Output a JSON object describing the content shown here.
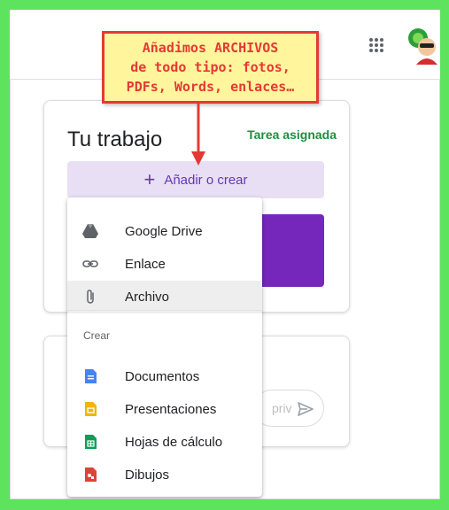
{
  "annotation": {
    "lines": [
      "Añadimos ARCHIVOS",
      "de todo tipo: fotos,",
      "PDFs, Words, enlaces…"
    ]
  },
  "topbar": {
    "apps_icon": "apps-grid-icon",
    "avatar_icon": "avatar-icon"
  },
  "work_card": {
    "title": "Tu trabajo",
    "status": "Tarea asignada",
    "add_button": {
      "icon": "+",
      "label": "Añadir o crear"
    }
  },
  "menu": {
    "items": [
      {
        "label": "Google Drive",
        "icon": "drive-icon"
      },
      {
        "label": "Enlace",
        "icon": "link-icon"
      },
      {
        "label": "Archivo",
        "icon": "attachment-icon",
        "active": true
      }
    ],
    "section_heading": "Crear",
    "create_items": [
      {
        "label": "Documentos",
        "icon": "docs-icon",
        "color": "#4285f4"
      },
      {
        "label": "Presentaciones",
        "icon": "slides-icon",
        "color": "#f4b400"
      },
      {
        "label": "Hojas de cálculo",
        "icon": "sheets-icon",
        "color": "#0f9d58"
      },
      {
        "label": "Dibujos",
        "icon": "drawings-icon",
        "color": "#db4437"
      }
    ]
  },
  "comment_card": {
    "placeholder_fragment": "priv"
  },
  "colors": {
    "accent": "#6735b8",
    "assigned": "#1e8e3e",
    "frame": "#5ee35e",
    "note_border": "#e53935",
    "note_fill": "#fff59d"
  }
}
